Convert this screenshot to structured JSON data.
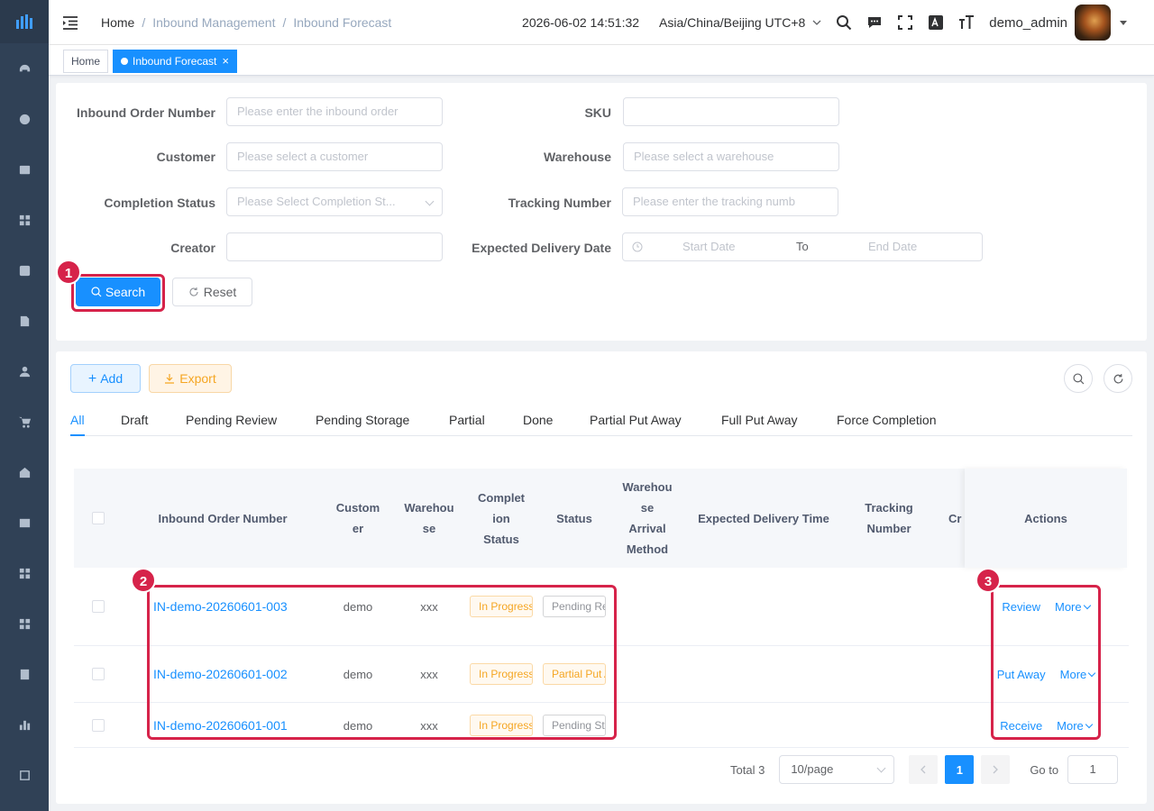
{
  "breadcrumb": [
    "Home",
    "Inbound Management",
    "Inbound Forecast"
  ],
  "header": {
    "datetime": "2026-06-02 14:51:32",
    "timezone": "Asia/China/Beijing UTC+8",
    "username": "demo_admin"
  },
  "tags": {
    "home": "Home",
    "active": "Inbound Forecast",
    "close": "×"
  },
  "form": {
    "order_number": {
      "label": "Inbound Order Number",
      "placeholder": "Please enter the inbound order"
    },
    "sku": {
      "label": "SKU",
      "placeholder": ""
    },
    "customer": {
      "label": "Customer",
      "placeholder": "Please select a customer"
    },
    "warehouse": {
      "label": "Warehouse",
      "placeholder": "Please select a warehouse"
    },
    "completion_status": {
      "label": "Completion Status",
      "placeholder": "Please Select Completion St..."
    },
    "tracking_number": {
      "label": "Tracking Number",
      "placeholder": "Please enter the tracking numb"
    },
    "creator": {
      "label": "Creator",
      "placeholder": ""
    },
    "expected_date": {
      "label": "Expected Delivery Date",
      "start": "Start Date",
      "to": "To",
      "end": "End Date"
    },
    "search_label": "Search",
    "reset_label": "Reset"
  },
  "toolbar": {
    "add_label": "Add",
    "export_label": "Export"
  },
  "tabs": [
    "All",
    "Draft",
    "Pending Review",
    "Pending Storage",
    "Partial",
    "Done",
    "Partial Put Away",
    "Full Put Away",
    "Force Completion"
  ],
  "table": {
    "headers": {
      "order": "Inbound Order Number",
      "customer": [
        "Custom",
        "er"
      ],
      "warehouse": [
        "Warehou",
        "se"
      ],
      "completion": [
        "Complet",
        "ion",
        "Status"
      ],
      "status": "Status",
      "arrival": [
        "Warehou",
        "se",
        "Arrival",
        "Method"
      ],
      "expected": "Expected Delivery Time",
      "tracking": [
        "Tracking",
        "Number"
      ],
      "creator": "Cr",
      "actions": "Actions"
    },
    "rows": [
      {
        "order": "IN-demo-20260601-003",
        "customer": "demo",
        "warehouse": "xxx",
        "completion": "In Progress",
        "status": "Pending Review",
        "action": "Review",
        "more": "More"
      },
      {
        "order": "IN-demo-20260601-002",
        "customer": "demo",
        "warehouse": "xxx",
        "completion": "In Progress",
        "status": "Partial Put Away",
        "action": "Put Away",
        "more": "More"
      },
      {
        "order": "IN-demo-20260601-001",
        "customer": "demo",
        "warehouse": "xxx",
        "completion": "In Progress",
        "status": "Pending Storage",
        "action": "Receive",
        "more": "More"
      }
    ]
  },
  "pagination": {
    "total": "Total 3",
    "page_size": "10/page",
    "current": "1",
    "goto_label": "Go to",
    "goto_value": "1"
  },
  "annotations": [
    "1",
    "2",
    "3"
  ],
  "colors": {
    "primary": "#1890ff",
    "sidebar": "#304156",
    "highlight": "#d6234a",
    "warning": "#f5a623"
  }
}
